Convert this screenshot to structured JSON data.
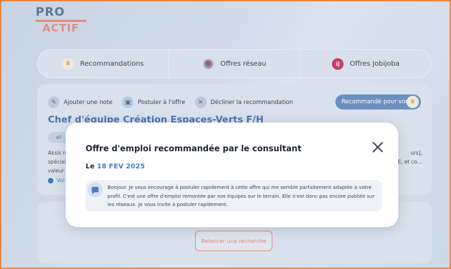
{
  "logo": {
    "line1": "PRO",
    "line2": "ACTIF"
  },
  "tabs": [
    {
      "label": "Recommandations",
      "icon": "crown-icon"
    },
    {
      "label": "Offres réseau",
      "icon": "target-icon"
    },
    {
      "label": "Offres Jobijoba",
      "icon": "jobijoba-icon",
      "icon_text": "ij"
    }
  ],
  "card": {
    "actions": [
      {
        "label": "Ajouter une note",
        "icon": "note-icon"
      },
      {
        "label": "Postuler à l'offre",
        "icon": "briefcase-icon"
      },
      {
        "label": "Décliner la recommandation",
        "icon": "decline-icon"
      }
    ],
    "recommended_label": "Recommandé pour vous",
    "job_title": "Chef d'équipe Création Espaces-Verts F/H",
    "chip": "AT",
    "desc_left": [
      "Aksis re",
      "spéciali",
      "valeur d"
    ],
    "desc_right": [
      "urs],",
      "E, et co…"
    ],
    "voir": "Voi"
  },
  "relaunch_label": "Relancer une recherche",
  "modal": {
    "title": "Offre d'emploi recommandée par le consultant",
    "date_prefix": "Le",
    "date": "18 FEV 2025",
    "message": "Bonjour. Je vous encourage à postuler rapidement à cette offre qui me semble parfaitement adaptée à votre profil. C'est une offre d'emploi remontée par nos équipes sur le terrain. Elle n'est donc pas encore publiée sur les réseaux. Je vous invite à postuler rapidement."
  },
  "colors": {
    "accent": "#4a7ec0",
    "brand_orange": "#e58a80",
    "frame": "#e8843c"
  }
}
